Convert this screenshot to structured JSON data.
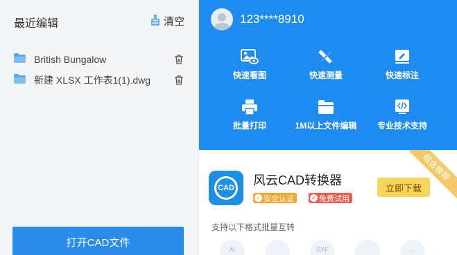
{
  "left_panel": {
    "title": "最近编辑",
    "clear_label": "清空",
    "files": [
      {
        "name": "British Bungalow"
      },
      {
        "name": "新建 XLSX 工作表1(1).dwg"
      }
    ],
    "open_button": "打开CAD文件"
  },
  "account": {
    "phone": "123****8910"
  },
  "features": [
    {
      "label": "快速看图",
      "icon": "image-eye-icon"
    },
    {
      "label": "快速测量",
      "icon": "ruler-pencil-icon"
    },
    {
      "label": "快速标注",
      "icon": "annotate-icon"
    },
    {
      "label": "批量打印",
      "icon": "printer-icon"
    },
    {
      "label": "1M以上文件编辑",
      "icon": "folder-icon"
    },
    {
      "label": "专业技术支持",
      "icon": "code-icon"
    }
  ],
  "promo": {
    "corner_label": "组合推荐",
    "app_name": "风云CAD转换器",
    "logo_text": "CAD",
    "badges": [
      "安全认证",
      "免费试用"
    ],
    "download_button": "立即下载",
    "support_text": "支持以下格式批量互转",
    "formats": [
      "AI",
      "",
      "DXF",
      "",
      "..."
    ]
  },
  "colors": {
    "blue_panel": "#1e8bf0",
    "open_button": "#2b8be9",
    "download_button": "#f8d65b",
    "badge_safe": "#f4a92e",
    "badge_free": "#f05a4a"
  }
}
